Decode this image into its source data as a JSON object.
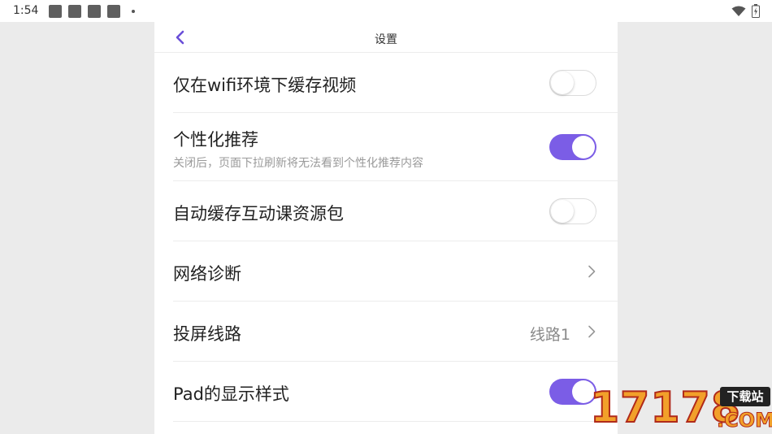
{
  "status_bar": {
    "time": "1:54"
  },
  "header": {
    "title": "设置"
  },
  "settings": [
    {
      "label": "仅在wifi环境下缓存视频",
      "control": "toggle",
      "state": "off"
    },
    {
      "label": "个性化推荐",
      "subtitle": "关闭后，页面下拉刷新将无法看到个性化推荐内容",
      "control": "toggle",
      "state": "on"
    },
    {
      "label": "自动缓存互动课资源包",
      "control": "toggle",
      "state": "off"
    },
    {
      "label": "网络诊断",
      "control": "chevron"
    },
    {
      "label": "投屏线路",
      "value": "线路1",
      "control": "chevron"
    },
    {
      "label": "Pad的显示样式",
      "control": "toggle",
      "state": "on"
    }
  ],
  "watermark": {
    "number": "17178",
    "badge": "下载站",
    "suffix": ".COM"
  },
  "colors": {
    "accent": "#7b5de6",
    "background": "#ebebeb",
    "panel": "#ffffff",
    "divider": "#ececec"
  },
  "icons": {
    "back": "chevron-left-icon",
    "row_arrow": "chevron-right-icon",
    "wifi": "wifi-icon",
    "battery": "battery-icon"
  }
}
